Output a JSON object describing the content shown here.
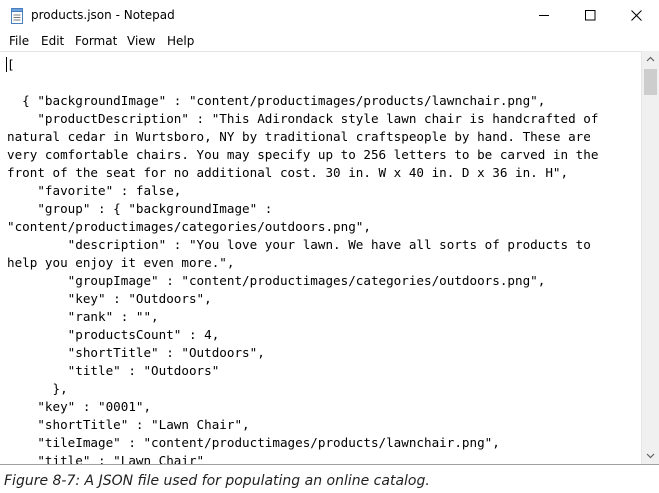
{
  "window": {
    "title": "products.json - Notepad"
  },
  "menu": {
    "file": "File",
    "edit": "Edit",
    "format": "Format",
    "view": "View",
    "help": "Help"
  },
  "editor": {
    "lines": [
      "[",
      "",
      "  { \"backgroundImage\" : \"content/productimages/products/lawnchair.png\",",
      "    \"productDescription\" : \"This Adirondack style lawn chair is handcrafted of",
      "natural cedar in Wurtsboro, NY by traditional craftspeople by hand. These are",
      "very comfortable chairs. You may specify up to 256 letters to be carved in the",
      "front of the seat for no additional cost. 30 in. W x 40 in. D x 36 in. H\",",
      "    \"favorite\" : false,",
      "    \"group\" : { \"backgroundImage\" :",
      "\"content/productimages/categories/outdoors.png\",",
      "        \"description\" : \"You love your lawn. We have all sorts of products to",
      "help you enjoy it even more.\",",
      "        \"groupImage\" : \"content/productimages/categories/outdoors.png\",",
      "        \"key\" : \"Outdoors\",",
      "        \"rank\" : \"\",",
      "        \"productsCount\" : 4,",
      "        \"shortTitle\" : \"Outdoors\",",
      "        \"title\" : \"Outdoors\"",
      "      },",
      "    \"key\" : \"0001\",",
      "    \"shortTitle\" : \"Lawn Chair\",",
      "    \"tileImage\" : \"content/productimages/products/lawnchair.png\",",
      "    \"title\" : \"Lawn Chair\""
    ]
  },
  "caption": "Figure 8-7: A JSON file used for populating an online catalog."
}
